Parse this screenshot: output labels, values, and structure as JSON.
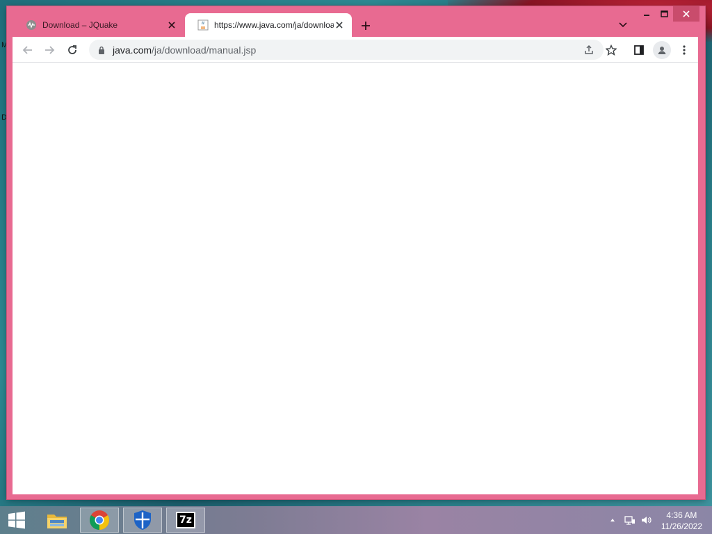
{
  "desktop": {
    "label_m": "M",
    "label_d": "D"
  },
  "browser": {
    "tabs": [
      {
        "title": "Download – JQuake",
        "icon": "jquake-favicon",
        "active": false
      },
      {
        "title": "https://www.java.com/ja/downloa",
        "icon": "java-favicon",
        "active": true
      }
    ],
    "address": {
      "host": "java.com",
      "path": "/ja/download/manual.jsp"
    }
  },
  "taskbar": {
    "items": [
      "start-button",
      "file-explorer",
      "chrome",
      "windows-defender",
      "7zip"
    ],
    "sevenzip_label": "7z",
    "time": "4:36 AM",
    "date": "11/26/2022"
  },
  "colors": {
    "window_frame": "#e86a91",
    "accent": "#c94c6c"
  }
}
